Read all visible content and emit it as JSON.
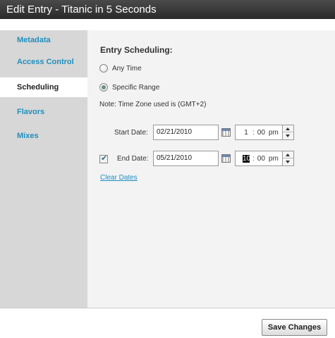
{
  "window": {
    "title": "Edit Entry - Titanic in 5 Seconds"
  },
  "sidebar": {
    "items": [
      {
        "label": "Metadata",
        "active": false
      },
      {
        "label": "Access Control",
        "active": false
      },
      {
        "label": "Scheduling",
        "active": true
      },
      {
        "label": "Flavors",
        "active": false
      },
      {
        "label": "Mixes",
        "active": false
      }
    ]
  },
  "scheduling": {
    "title": "Entry Scheduling:",
    "option_any": "Any Time",
    "option_range": "Specific Range",
    "selected_option": "Specific Range",
    "note": "Note: Time Zone used is (GMT+2)",
    "start": {
      "label": "Start Date:",
      "date": "02/21/2010",
      "hour": "1",
      "minute": "00",
      "ampm": "pm"
    },
    "end": {
      "label": "End Date:",
      "enabled": true,
      "date": "05/21/2010",
      "hour": "10",
      "minute": "00",
      "ampm": "pm"
    },
    "clear_dates": "Clear Dates"
  },
  "footer": {
    "save_label": "Save Changes"
  },
  "colors": {
    "accent_link": "#1e8fbf",
    "titlebar": "#333333",
    "sidebar_bg": "#d7d7d7"
  },
  "icons": [
    "calendar-icon",
    "chevron-up-icon",
    "chevron-down-icon",
    "checkmark-icon"
  ]
}
